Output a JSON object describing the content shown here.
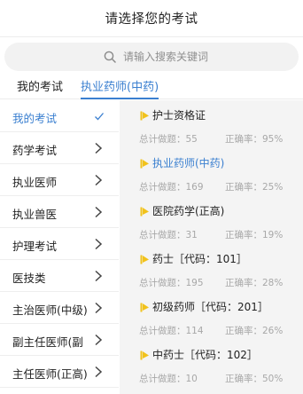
{
  "header": {
    "title": "请选择您的考试"
  },
  "search": {
    "placeholder": "请输入搜索关键词"
  },
  "tabs": [
    {
      "label": "我的考试",
      "active": false
    },
    {
      "label": "执业药师(中药)",
      "active": true
    }
  ],
  "sidebar": {
    "items": [
      {
        "label": "我的考试",
        "active": true,
        "icon": "check-icon"
      },
      {
        "label": "药学考试",
        "active": false,
        "icon": "chevron-right-icon"
      },
      {
        "label": "执业医师",
        "active": false,
        "icon": "chevron-right-icon"
      },
      {
        "label": "执业兽医",
        "active": false,
        "icon": "chevron-right-icon"
      },
      {
        "label": "护理考试",
        "active": false,
        "icon": "chevron-right-icon"
      },
      {
        "label": "医技类",
        "active": false,
        "icon": "chevron-right-icon"
      },
      {
        "label": "主治医师(中级)",
        "active": false,
        "icon": "chevron-right-icon"
      },
      {
        "label": "副主任医师(副",
        "active": false,
        "icon": "chevron-right-icon"
      },
      {
        "label": "主任医师(正高)",
        "active": false,
        "icon": "chevron-right-icon"
      }
    ]
  },
  "exams": [
    {
      "name": "护士资格证",
      "count": "总计做题：55",
      "rate": "正确率：95%",
      "active": false
    },
    {
      "name": "执业药师(中药)",
      "count": "总计做题：169",
      "rate": "正确率：25%",
      "active": true
    },
    {
      "name": "医院药学(正高)",
      "count": "总计做题：31",
      "rate": "正确率：19%",
      "active": false
    },
    {
      "name": "药士［代码：101］",
      "count": "总计做题：195",
      "rate": "正确率：28%",
      "active": false
    },
    {
      "name": "初级药师［代码：201］",
      "count": "总计做题：114",
      "rate": "正确率：26%",
      "active": false
    },
    {
      "name": "中药士［代码：102］",
      "count": "总计做题：10",
      "rate": "正确率：50%",
      "active": false
    }
  ],
  "colors": {
    "accent": "#3a7fd0",
    "flag_yellow": "#f1c21b",
    "muted_text": "#a8a8a8",
    "content_bg": "#f4f4f4"
  }
}
